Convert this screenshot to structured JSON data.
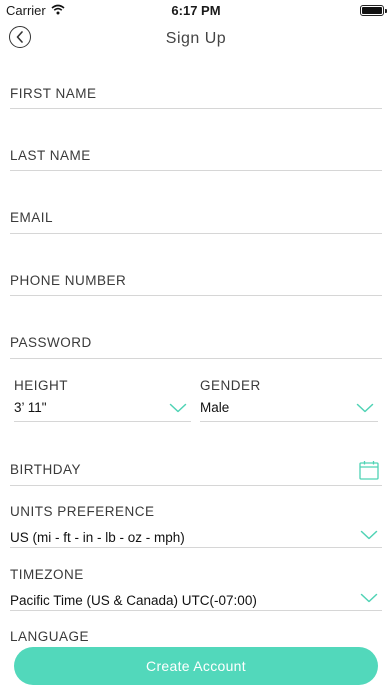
{
  "status": {
    "carrier": "Carrier",
    "time": "6:17 PM"
  },
  "nav": {
    "title": "Sign Up"
  },
  "form": {
    "first_name_label": "FIRST NAME",
    "last_name_label": "LAST NAME",
    "email_label": "EMAIL",
    "phone_label": "PHONE NUMBER",
    "password_label": "PASSWORD",
    "height_label": "HEIGHT",
    "height_value": "3’ 11\"",
    "gender_label": "GENDER",
    "gender_value": "Male",
    "birthday_label": "BIRTHDAY",
    "units_label": "UNITS PREFERENCE",
    "units_value": "US (mi - ft - in - lb - oz - mph)",
    "timezone_label": "TIMEZONE",
    "timezone_value": "Pacific Time (US & Canada) UTC(-07:00)",
    "language_label": "LANGUAGE"
  },
  "actions": {
    "create_label": "Create Account"
  },
  "colors": {
    "accent": "#52d8bb",
    "chevron": "#4fd3b5"
  }
}
